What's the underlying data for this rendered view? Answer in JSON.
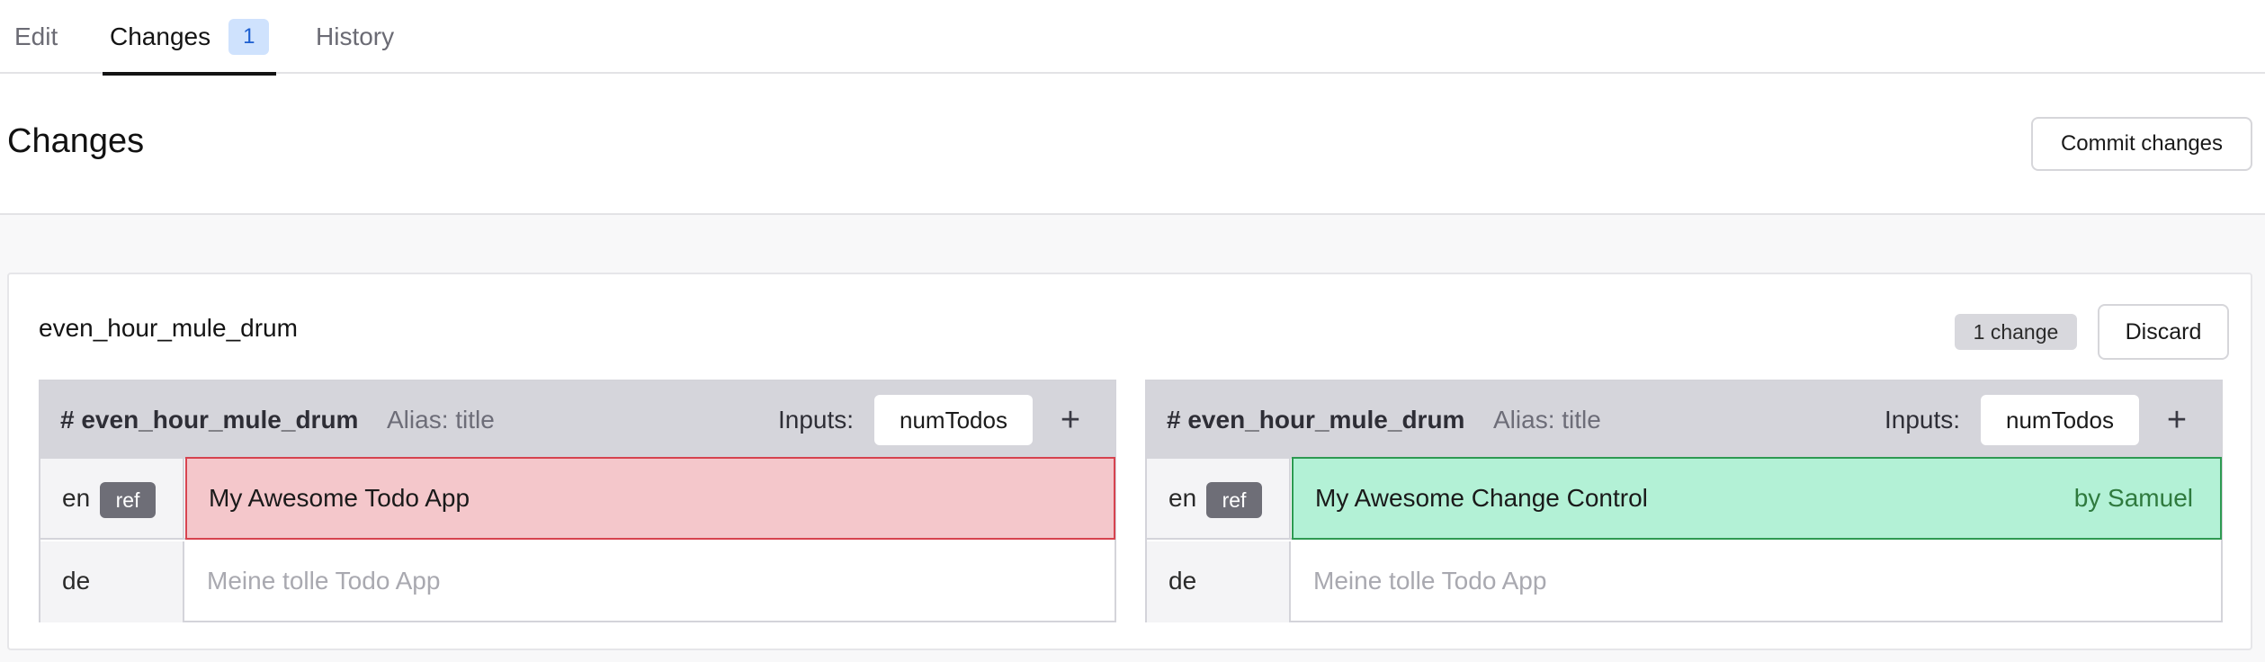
{
  "tabs": [
    {
      "label": "Edit"
    },
    {
      "label": "Changes",
      "badge": "1",
      "active": true
    },
    {
      "label": "History"
    }
  ],
  "header": {
    "title": "Changes",
    "commit_label": "Commit changes"
  },
  "card": {
    "title": "even_hour_mule_drum",
    "change_count": "1 change",
    "discard_label": "Discard"
  },
  "panels": [
    {
      "key": "# even_hour_mule_drum",
      "alias": "Alias: title",
      "inputs_label": "Inputs:",
      "input_chip": "numTodos",
      "add_icon": "+",
      "rows": [
        {
          "lang": "en",
          "ref": "ref",
          "value": "My Awesome Todo App",
          "state": "removed"
        },
        {
          "lang": "de",
          "placeholder": "Meine tolle Todo App"
        }
      ]
    },
    {
      "key": "# even_hour_mule_drum",
      "alias": "Alias: title",
      "inputs_label": "Inputs:",
      "input_chip": "numTodos",
      "add_icon": "+",
      "rows": [
        {
          "lang": "en",
          "ref": "ref",
          "value": "My Awesome Change Control",
          "author": "by Samuel",
          "state": "added"
        },
        {
          "lang": "de",
          "placeholder": "Meine tolle Todo App"
        }
      ]
    }
  ],
  "colors": {
    "removed_bg": "#f4c7cb",
    "removed_border": "#d6434f",
    "added_bg": "#b3f1d6",
    "added_border": "#2e9a52",
    "badge_blue": "#cfe2fd"
  }
}
